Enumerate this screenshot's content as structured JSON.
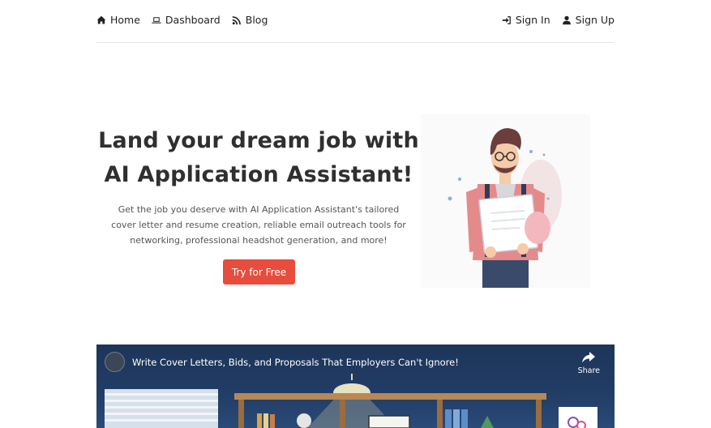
{
  "nav": {
    "left": [
      {
        "label": "Home",
        "icon": "home-icon"
      },
      {
        "label": "Dashboard",
        "icon": "laptop-icon"
      },
      {
        "label": "Blog",
        "icon": "rss-icon"
      }
    ],
    "right": [
      {
        "label": "Sign In",
        "icon": "sign-in-icon"
      },
      {
        "label": "Sign Up",
        "icon": "user-icon"
      }
    ]
  },
  "hero": {
    "title_line1": "Land your dream job with",
    "title_line2": "AI Application Assistant!",
    "subtitle_line1": "Get the job you deserve with AI Application Assistant's tailored",
    "subtitle_line2": "cover letter and resume creation, reliable email outreach tools for",
    "subtitle_line3": "networking, professional headshot generation, and more!",
    "cta_label": "Try for Free"
  },
  "video": {
    "title": "Write Cover Letters, Bids, and Proposals That Employers Can't Ignore!",
    "share_label": "Share"
  },
  "colors": {
    "accent": "#e74c3c",
    "video_bg": "#223d66"
  }
}
